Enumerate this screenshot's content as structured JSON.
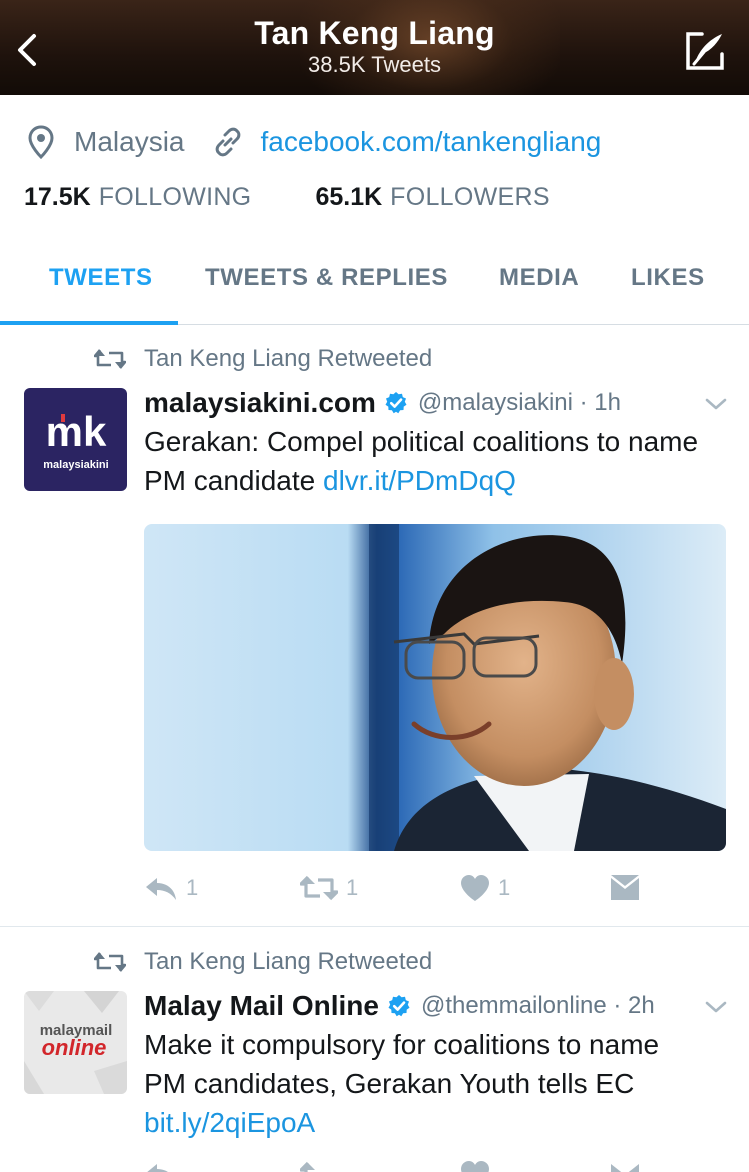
{
  "header": {
    "title": "Tan Keng Liang",
    "subtitle": "38.5K Tweets",
    "back_icon": "chevron-left-icon",
    "compose_icon": "compose-tweet-icon"
  },
  "profile": {
    "location": "Malaysia",
    "website": "facebook.com/tankengliang",
    "following_count": "17.5K",
    "following_label": "FOLLOWING",
    "followers_count": "65.1K",
    "followers_label": "FOLLOWERS"
  },
  "tabs": [
    {
      "label": "TWEETS",
      "active": true
    },
    {
      "label": "TWEETS & REPLIES",
      "active": false
    },
    {
      "label": "MEDIA",
      "active": false
    },
    {
      "label": "LIKES",
      "active": false
    }
  ],
  "tweets": [
    {
      "retweet_note": "Tan Keng Liang Retweeted",
      "avatar_logo_big": "mk",
      "avatar_logo_small": "malaysiakini",
      "name": "malaysiakini.com",
      "handle_time": "@malaysiakini · 1h",
      "text": "Gerakan: Compel political coalitions to name PM candidate ",
      "link": "dlvr.it/PDmDqQ",
      "reply_count": "1",
      "retweet_count": "1",
      "like_count": "1"
    },
    {
      "retweet_note": "Tan Keng Liang Retweeted",
      "avatar_logo_top": "malaymail",
      "avatar_logo_bottom": "online",
      "name": "Malay Mail Online",
      "handle_time": "@themmailonline · 2h",
      "text": "Make it compulsory for coalitions to name PM candidates, Gerakan Youth tells EC ",
      "link": "bit.ly/2qiEpoA"
    }
  ],
  "colors": {
    "accent": "#1da1f2",
    "link": "#1b95e0",
    "muted": "#657786",
    "avatar_bg": "#2b2462"
  }
}
